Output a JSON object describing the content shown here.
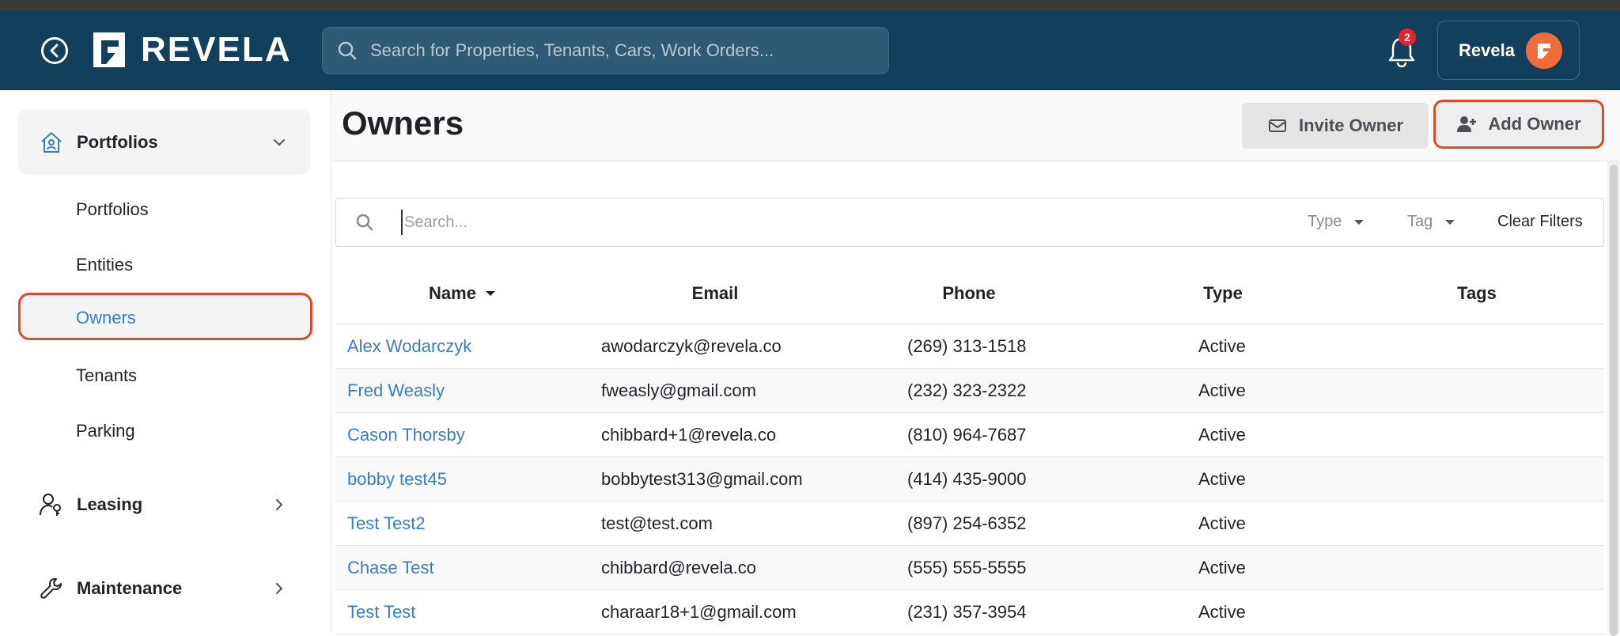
{
  "header": {
    "logo_text": "REVELA",
    "search_placeholder": "Search for Properties, Tenants, Cars, Work Orders...",
    "notification_count": "2",
    "user_name": "Revela"
  },
  "sidebar": {
    "sections": [
      {
        "label": "Portfolios",
        "expanded": true
      },
      {
        "label": "Leasing",
        "expanded": false
      },
      {
        "label": "Maintenance",
        "expanded": false
      }
    ],
    "portfolio_items": [
      "Portfolios",
      "Entities",
      "Owners",
      "Tenants",
      "Parking"
    ],
    "active_item": "Owners"
  },
  "page": {
    "title": "Owners",
    "invite_label": "Invite Owner",
    "add_label": "Add Owner"
  },
  "filters": {
    "search_placeholder": "Search...",
    "type_label": "Type",
    "tag_label": "Tag",
    "clear_label": "Clear Filters"
  },
  "table": {
    "columns": [
      "Name",
      "Email",
      "Phone",
      "Type",
      "Tags"
    ],
    "rows": [
      {
        "name": "Alex Wodarczyk",
        "email": "awodarczyk@revela.co",
        "phone": "(269) 313-1518",
        "type": "Active",
        "tags": ""
      },
      {
        "name": "Fred Weasly",
        "email": "fweasly@gmail.com",
        "phone": "(232) 323-2322",
        "type": "Active",
        "tags": ""
      },
      {
        "name": "Cason Thorsby",
        "email": "chibbard+1@revela.co",
        "phone": "(810) 964-7687",
        "type": "Active",
        "tags": ""
      },
      {
        "name": "bobby test45",
        "email": "bobbytest313@gmail.com",
        "phone": "(414) 435-9000",
        "type": "Active",
        "tags": ""
      },
      {
        "name": "Test Test2",
        "email": "test@test.com",
        "phone": "(897) 254-6352",
        "type": "Active",
        "tags": ""
      },
      {
        "name": "Chase Test",
        "email": "chibbard@revela.co",
        "phone": "(555) 555-5555",
        "type": "Active",
        "tags": ""
      },
      {
        "name": "Test Test",
        "email": "charaar18+1@gmail.com",
        "phone": "(231) 357-3954",
        "type": "Active",
        "tags": ""
      }
    ]
  },
  "colors": {
    "header_bg": "#123f5c",
    "link": "#3b7dc4",
    "highlight_outline": "#e84530",
    "avatar": "#f26b3a",
    "badge": "#e0262c"
  }
}
